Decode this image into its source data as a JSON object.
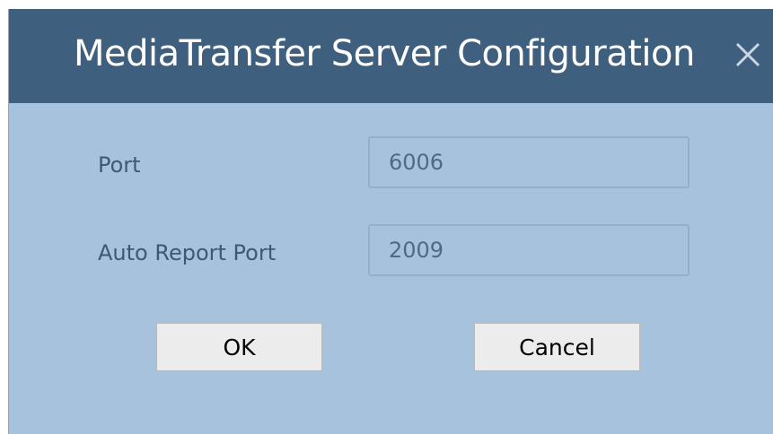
{
  "dialog": {
    "title": "MediaTransfer Server Configuration",
    "close_icon": "close-icon"
  },
  "fields": {
    "port": {
      "label": "Port",
      "value": "6006"
    },
    "auto_report_port": {
      "label": "Auto Report Port",
      "value": "2009"
    }
  },
  "buttons": {
    "ok_label": "OK",
    "cancel_label": "Cancel"
  },
  "colors": {
    "titlebar": "#3f5f7f",
    "body": "#a6c2dc",
    "label_text": "#3f5873",
    "button_bg": "#ececec"
  }
}
